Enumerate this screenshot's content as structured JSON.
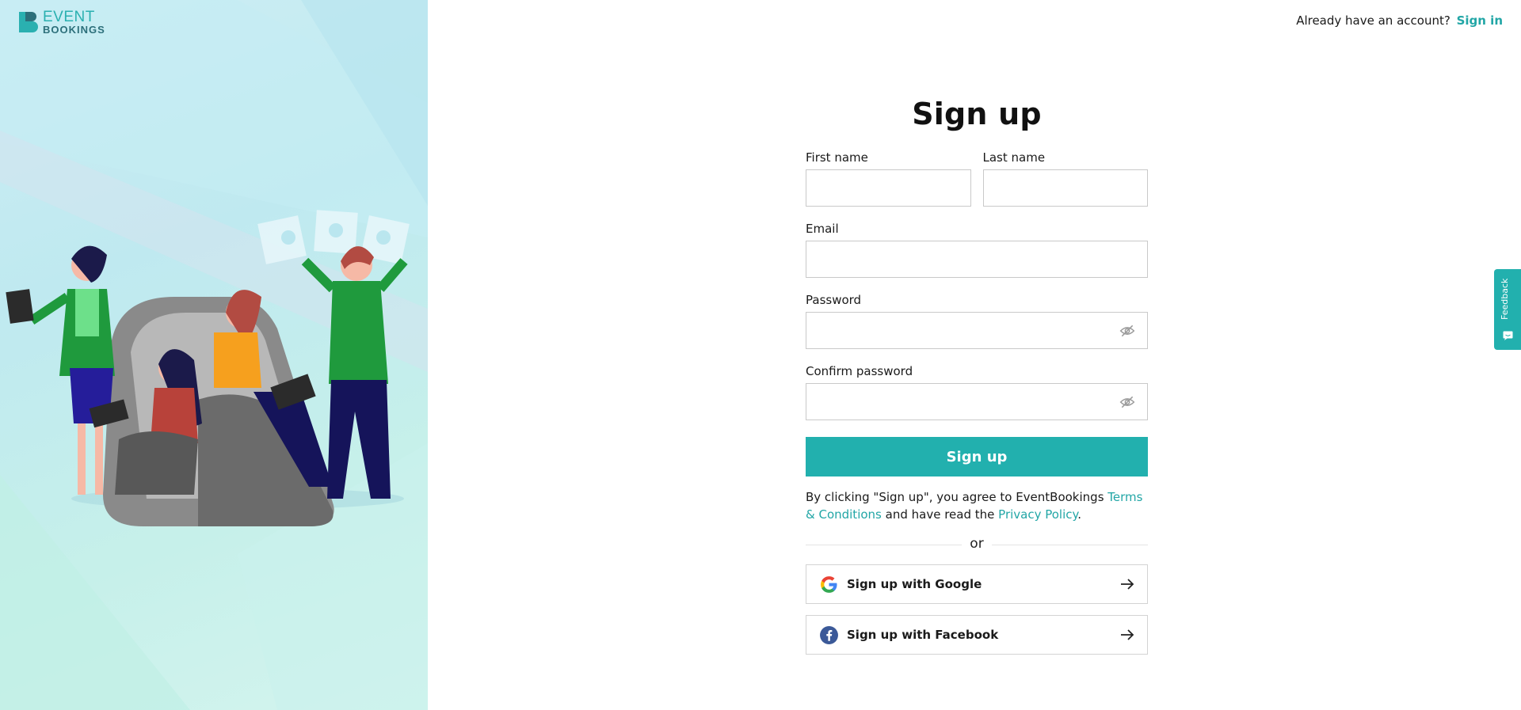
{
  "brand": {
    "name_line1": "EVENT",
    "name_line2": "BOOKINGS",
    "accent": "#22b0ae"
  },
  "header": {
    "prompt": "Already have an account?",
    "signin_label": "Sign in"
  },
  "form": {
    "title": "Sign up",
    "first_name": {
      "label": "First name",
      "value": ""
    },
    "last_name": {
      "label": "Last name",
      "value": ""
    },
    "email": {
      "label": "Email",
      "value": ""
    },
    "password": {
      "label": "Password",
      "value": "",
      "toggle_icon": "eye-off-icon"
    },
    "confirm_password": {
      "label": "Confirm password",
      "value": "",
      "toggle_icon": "eye-off-icon"
    },
    "submit_label": "Sign up"
  },
  "terms": {
    "prefix": "By clicking \"Sign up\", you agree to EventBookings",
    "terms_link": "Terms & Conditions",
    "middle": "and have read the",
    "privacy_link": "Privacy Policy",
    "suffix": "."
  },
  "divider_text": "or",
  "social": [
    {
      "label": "Sign up with Google",
      "icon": "google-icon"
    },
    {
      "label": "Sign up with Facebook",
      "icon": "facebook-icon"
    }
  ],
  "feedback": {
    "label": "Feedback"
  }
}
